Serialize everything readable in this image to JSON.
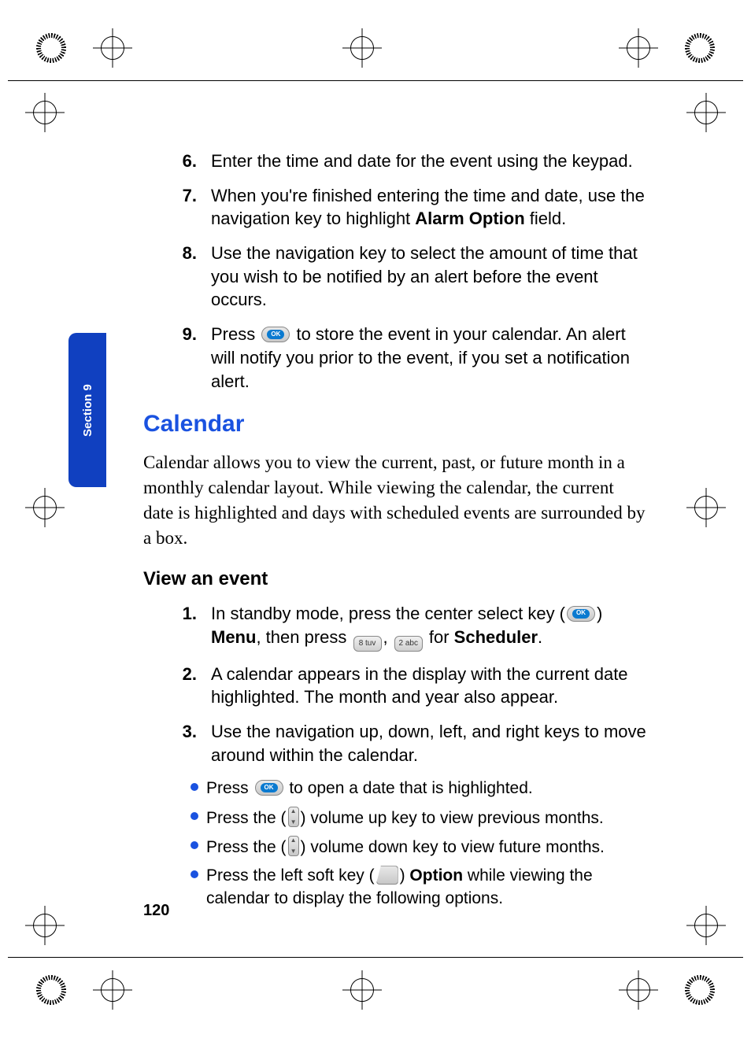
{
  "page_number": "120",
  "section_tab": "Section 9",
  "steps_a": [
    {
      "num": "6.",
      "text": "Enter the time and date for the event using the keypad."
    },
    {
      "num": "7.",
      "pre": "When you're finished entering the time and date, use the navigation key to highlight ",
      "strong": "Alarm Option",
      "post": " field."
    },
    {
      "num": "8.",
      "text": "Use the navigation key to select the amount of time that you wish to be notified by an alert before the event occurs."
    },
    {
      "num": "9.",
      "pre": "Press ",
      "icon": "ok",
      "post": " to store the event in your calendar. An alert will notify you prior to the event, if you set a notification alert."
    }
  ],
  "heading": "Calendar",
  "intro": "Calendar allows you to view the current, past, or future month in a monthly calendar layout. While viewing the calendar, the current date is highlighted and days with scheduled events are surrounded by a box.",
  "subheading": "View an event",
  "steps_b": [
    {
      "num": "1.",
      "pre": "In standby mode, press the center select key (",
      "icon1": "ok",
      "mid1": ") ",
      "strong1": "Menu",
      "mid2": ", then press ",
      "icon2": "8",
      "mid3": ", ",
      "icon3": "2",
      "mid4": " for ",
      "strong2": "Scheduler",
      "post": "."
    },
    {
      "num": "2.",
      "text": "A calendar appears in the display with the current date highlighted. The month and year also appear."
    },
    {
      "num": "3.",
      "text": "Use the navigation up, down, left, and right keys to move around within the calendar."
    }
  ],
  "bullets": [
    {
      "pre": "Press ",
      "icon": "ok",
      "post": " to open a date that is highlighted."
    },
    {
      "pre": "Press the (",
      "icon": "vol",
      "post": ") volume up key to view previous months."
    },
    {
      "pre": "Press the (",
      "icon": "vol",
      "post": ") volume down key to view future months."
    },
    {
      "pre": "Press the left soft key (",
      "icon": "soft",
      "mid": ") ",
      "strong": "Option",
      "post": " while viewing the calendar to display the following options."
    }
  ]
}
